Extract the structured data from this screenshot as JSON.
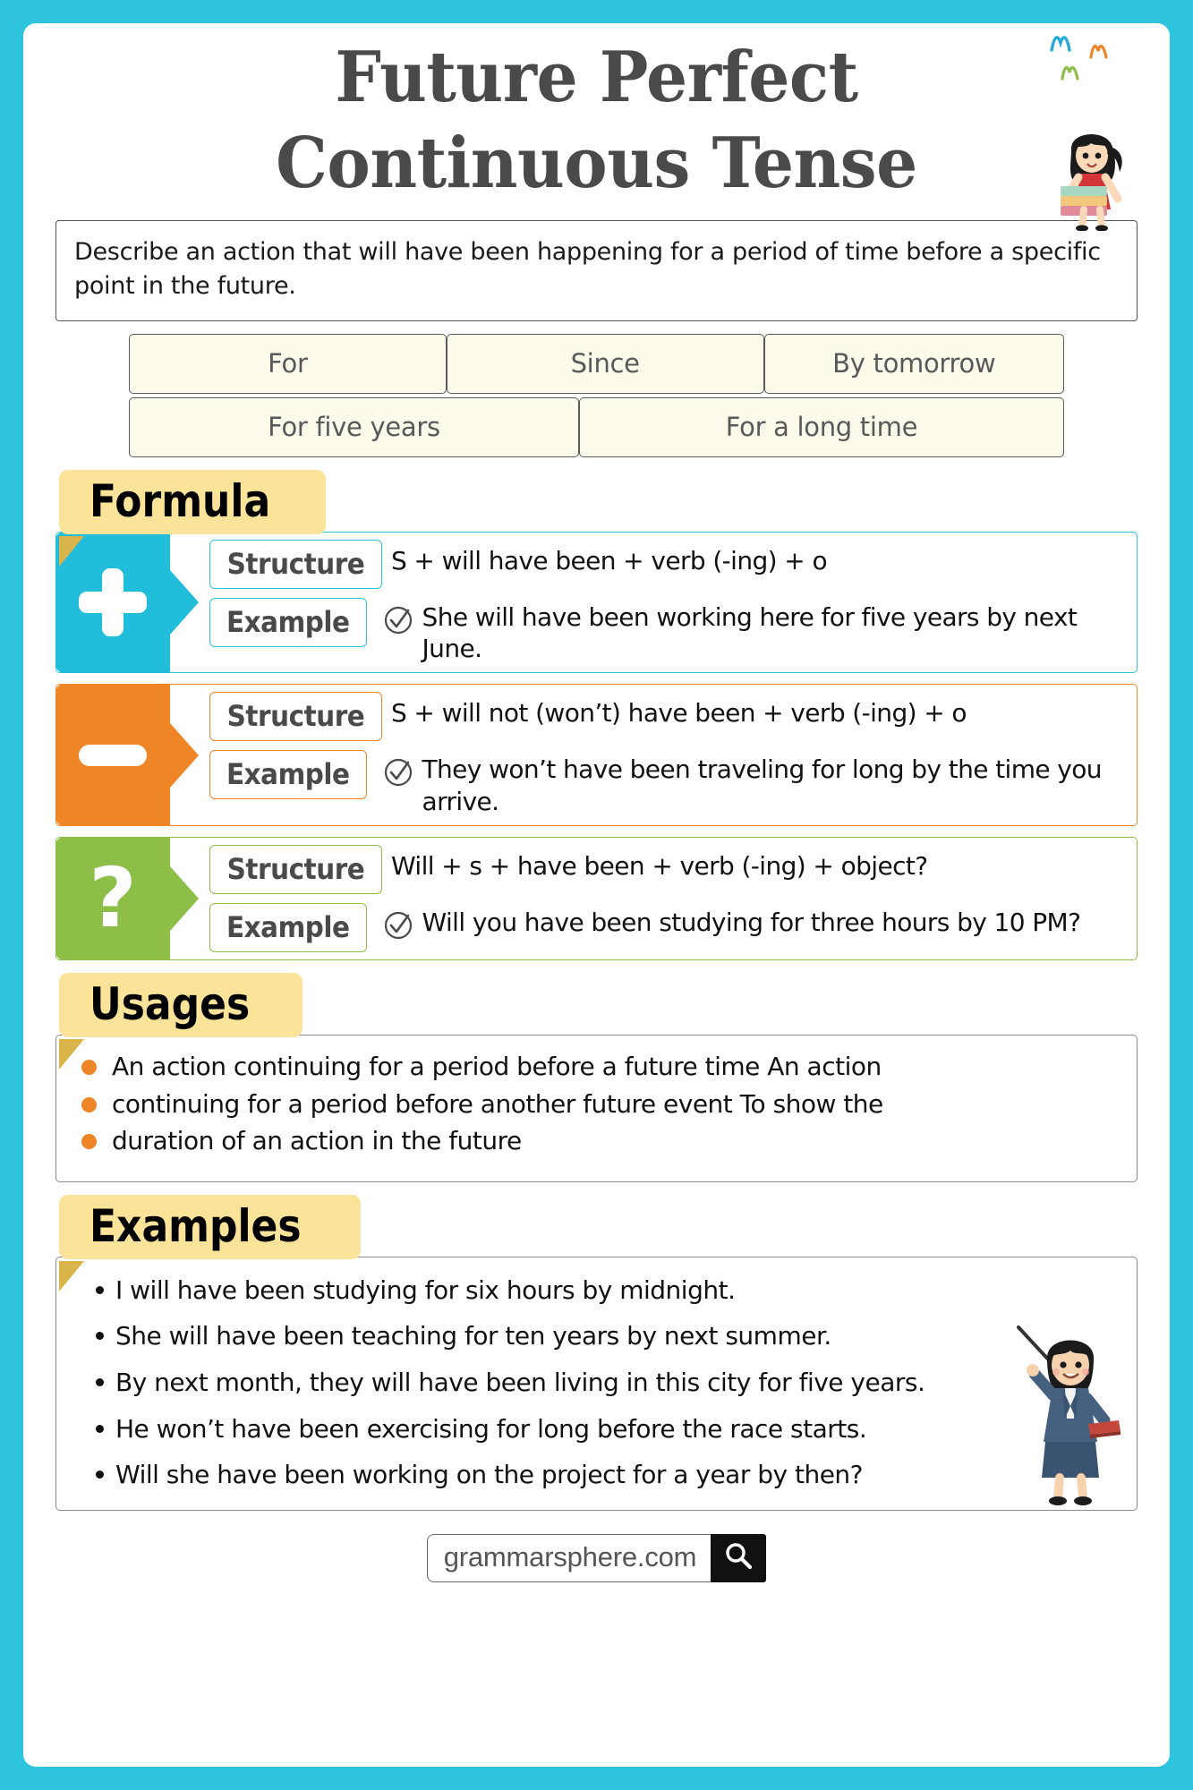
{
  "title": {
    "line1": "Future Perfect",
    "line2": "Continuous Tense"
  },
  "definition": "Describe an action that will have been happening for a period of time before a specific point in the future.",
  "keywords": {
    "row1": [
      "For",
      "Since",
      "By tomorrow"
    ],
    "row2": [
      "For five years",
      "For a long time"
    ]
  },
  "sections": {
    "formula_label": "Formula",
    "usages_label": "Usages",
    "examples_label": "Examples"
  },
  "labels": {
    "structure": "Structure",
    "example": "Example"
  },
  "formula": [
    {
      "type": "affirmative",
      "glyph": "plus-icon",
      "color": "#21BDDB",
      "structure": "S + will have been + verb (-ing) + o",
      "example": "She will have been working here for five years by next June."
    },
    {
      "type": "negative",
      "glyph": "minus-icon",
      "color": "#EE8527",
      "structure": "S + will not (won’t) have been + verb (-ing) + o",
      "example": "They won’t have been traveling for long by the time you arrive."
    },
    {
      "type": "interrogative",
      "glyph": "question-icon",
      "color": "#8DBE48",
      "structure": "Will + s + have been + verb (-ing) + object?",
      "example": "Will you have been studying for three hours by 10 PM?"
    }
  ],
  "usages": [
    "An action continuing for a period before a future time An action",
    "continuing for a period before another future event To show the",
    "duration of an action in the future"
  ],
  "examples": [
    "I will have been studying for six hours by midnight.",
    "She will have been teaching for ten years by next summer.",
    "By next month, they will have been living in this city for five years.",
    "He won’t have been exercising for long before the race starts.",
    "Will she have been working on the project for a year by then?"
  ],
  "footer": {
    "site": "grammarsphere.com",
    "search_icon": "search-icon"
  },
  "colors": {
    "background": "#2EC4DE",
    "tab": "#FCE39A",
    "tab_fold": "#D8B44A",
    "chip": "#FCFAEA",
    "cyan": "#21BDDB",
    "orange": "#EE8527",
    "green": "#8DBE48"
  }
}
